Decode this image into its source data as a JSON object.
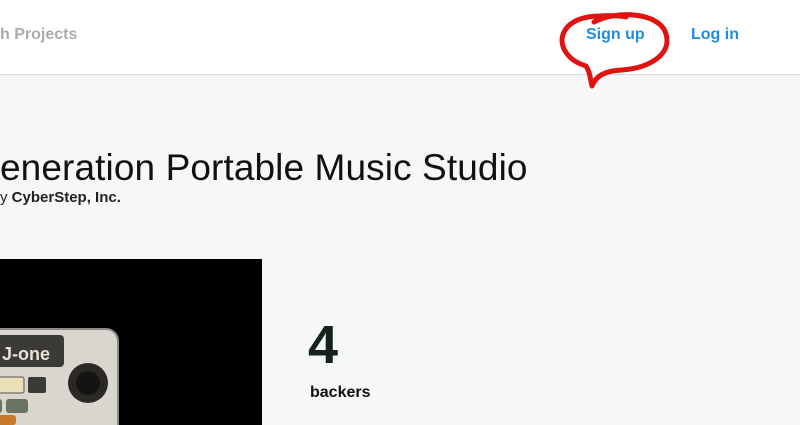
{
  "header": {
    "search_text": "h Projects",
    "signup_label": "Sign up",
    "login_label": "Log in",
    "annotation_color": "#e11212",
    "link_color": "#1e8de0"
  },
  "project": {
    "title": "eneration Portable Music Studio",
    "creator_prefix": "y",
    "creator_name": "CyberStep, Inc.",
    "device_brand": "J-one"
  },
  "stats": {
    "backers_count": "4",
    "backers_label": "backers"
  }
}
